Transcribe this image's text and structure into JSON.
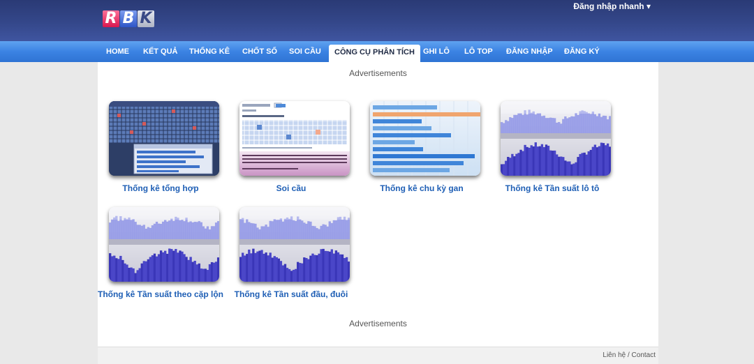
{
  "header": {
    "logo_letters": [
      "R",
      "B",
      "K"
    ],
    "login_quick": "Đăng nhập nhanh ▾"
  },
  "nav": {
    "items": [
      {
        "label": "HOME",
        "active": false
      },
      {
        "label": "KẾT QUẢ",
        "active": false
      },
      {
        "label": "THỐNG KÊ",
        "active": false
      },
      {
        "label": "CHỐT SỐ",
        "active": false
      },
      {
        "label": "SOI CẦU",
        "active": false
      },
      {
        "label": "CÔNG CỤ PHÂN TÍCH",
        "active": true
      },
      {
        "label": "GHI LÔ",
        "active": false
      },
      {
        "label": "LÔ TOP",
        "active": false
      },
      {
        "label": "ĐĂNG NHẬP",
        "active": false
      },
      {
        "label": "ĐĂNG KÝ",
        "active": false
      }
    ]
  },
  "main": {
    "ads_top": "Advertisements",
    "ads_bottom": "Advertisements",
    "tools": [
      {
        "caption": "Thống kê tổng hợp",
        "icon": "summary-stats-thumbnail"
      },
      {
        "caption": "Soi cầu",
        "icon": "soi-cau-thumbnail"
      },
      {
        "caption": "Thống kê chu kỳ gan",
        "icon": "gan-cycle-thumbnail"
      },
      {
        "caption": "Thống kê Tần suất lô tô",
        "icon": "frequency-chart-thumbnail"
      },
      {
        "caption": "Thống kê Tần suất theo cặp lộn",
        "icon": "frequency-chart-thumbnail"
      },
      {
        "caption": "Thống kê Tần suất đầu, đuôi",
        "icon": "frequency-chart-thumbnail"
      }
    ]
  },
  "footer": {
    "contact": "Liên hệ / Contact"
  },
  "colors": {
    "header_bg": "#34478a",
    "nav_bg": "#3b83e3",
    "caption_text": "#1f5fb5",
    "page_bg": "#e9e9e9"
  }
}
